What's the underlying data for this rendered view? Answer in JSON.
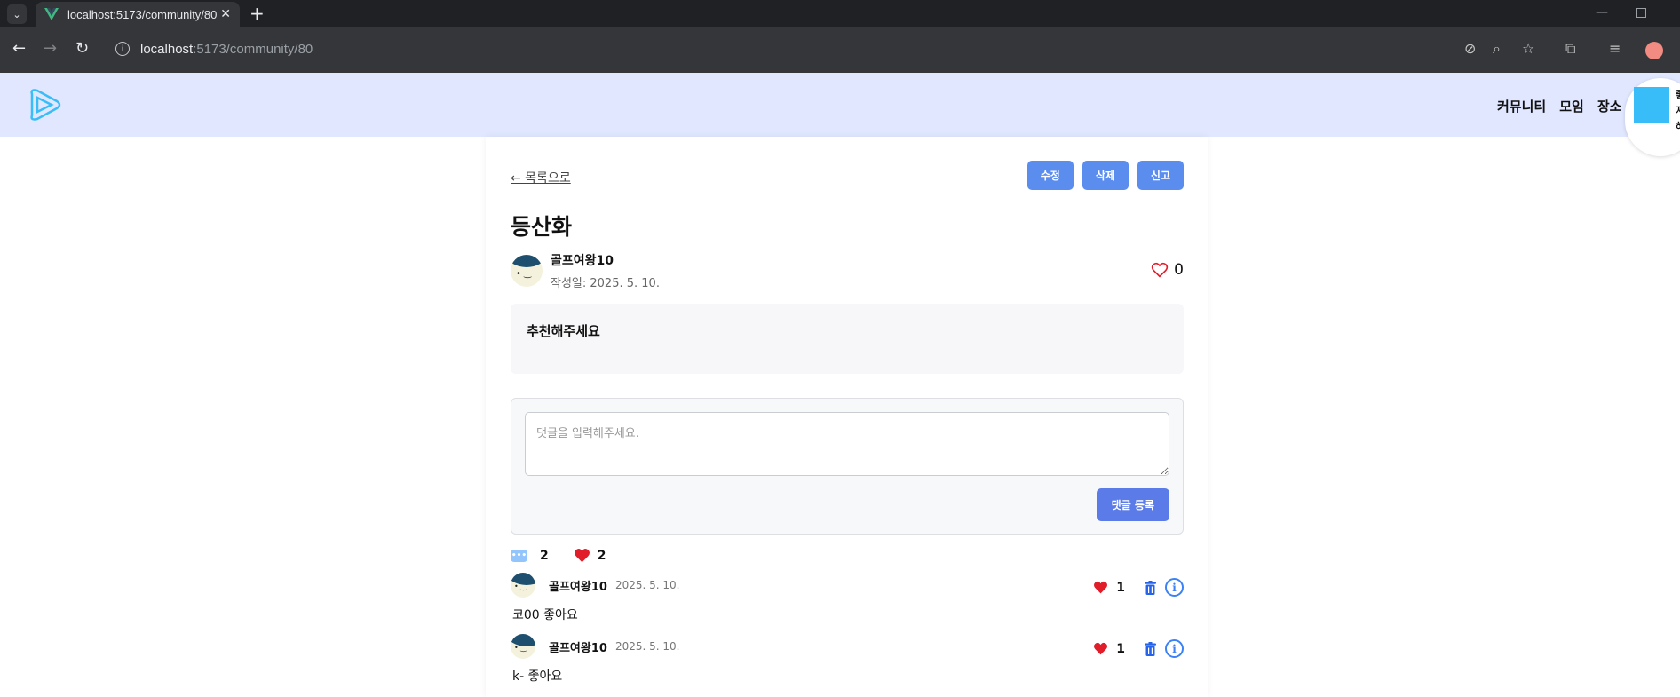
{
  "browser": {
    "tab_title": "localhost:5173/community/80",
    "url_host": "localhost",
    "url_path": ":5173/community/80"
  },
  "header": {
    "nav": [
      "커뮤니티",
      "모임",
      "장소"
    ],
    "user_card_lines": [
      "좋",
      "지",
      "하"
    ]
  },
  "post": {
    "back_label": "← 목록으로",
    "actions": {
      "edit": "수정",
      "delete": "삭제",
      "report": "신고"
    },
    "title": "등산화",
    "author": "골프여왕10",
    "date": "작성일: 2025. 5. 10.",
    "like_count": "0",
    "body": "추천해주세요"
  },
  "comment_form": {
    "placeholder": "댓글을 입력해주세요.",
    "submit_label": "댓글 등록"
  },
  "stats": {
    "comment_count": "2",
    "like_count": "2"
  },
  "comments": [
    {
      "author": "골프여왕10",
      "date": "2025. 5. 10.",
      "likes": "1",
      "text": "코00 좋아요"
    },
    {
      "author": "골프여왕10",
      "date": "2025. 5. 10.",
      "likes": "1",
      "text": "k- 좋아요"
    }
  ],
  "colors": {
    "header_bg": "#e0e7ff",
    "button_blue": "#5b8def",
    "heart_red": "#e11d2a",
    "trash_blue": "#2563eb"
  }
}
